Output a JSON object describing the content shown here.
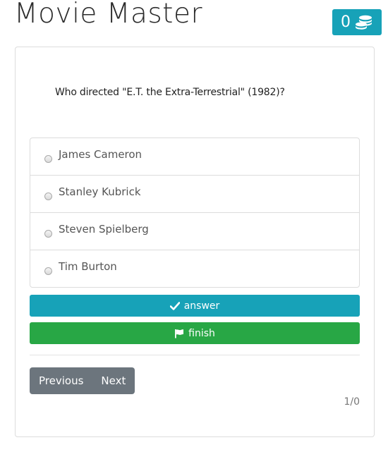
{
  "header": {
    "title": "Movie Master",
    "coins": "0",
    "coin_icon": "coins-icon",
    "accent_color": "#17a2b8"
  },
  "quiz": {
    "question": "Who directed \"E.T. the Extra-Terrestrial\" (1982)?",
    "options": [
      {
        "label": "James Cameron"
      },
      {
        "label": "Stanley Kubrick"
      },
      {
        "label": "Steven Spielberg"
      },
      {
        "label": "Tim Burton"
      }
    ],
    "answer_label": "answer",
    "answer_icon": "check-icon",
    "answer_color": "#17a2b8",
    "finish_label": "finish",
    "finish_icon": "flag-icon",
    "finish_color": "#28a745"
  },
  "pagination": {
    "previous_label": "Previous",
    "next_label": "Next",
    "progress": "1/0"
  }
}
